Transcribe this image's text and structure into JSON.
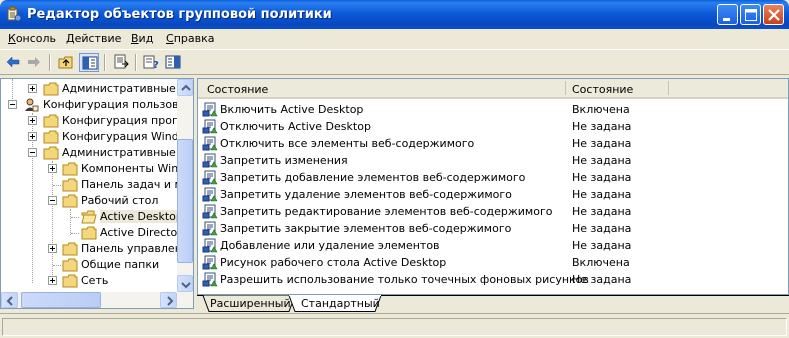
{
  "window": {
    "title": "Редактор объектов групповой политики",
    "controls": [
      "minimize",
      "maximize",
      "close"
    ]
  },
  "menu": {
    "items": [
      {
        "label": "Консоль",
        "accesskey": "К"
      },
      {
        "label": "Действие",
        "accesskey": "Д"
      },
      {
        "label": "Вид",
        "accesskey": "В"
      },
      {
        "label": "Справка",
        "accesskey": "С"
      }
    ]
  },
  "toolbar": {
    "buttons": [
      "back-icon",
      "forward-icon",
      "up-folder-icon",
      "show-hide-tree-icon",
      "export-list-icon",
      "properties-help-icon",
      "show-hide-action-pane-icon"
    ]
  },
  "tree": {
    "items": [
      {
        "label": "Административные ш",
        "expander": "plus"
      },
      {
        "label": "Конфигурация пользоват",
        "expander": "minus"
      },
      {
        "label": "Конфигурация програ",
        "expander": "plus"
      },
      {
        "label": "Конфигурация Window",
        "expander": "plus"
      },
      {
        "label": "Административные ш",
        "expander": "minus"
      },
      {
        "label": "Компоненты Windo",
        "expander": "plus"
      },
      {
        "label": "Панель задач и ме",
        "expander": "none"
      },
      {
        "label": "Рабочий стол",
        "expander": "minus"
      },
      {
        "label": "Active Desktop",
        "expander": "none",
        "selected": true
      },
      {
        "label": "Active Directory",
        "expander": "none"
      },
      {
        "label": "Панель управлени",
        "expander": "plus"
      },
      {
        "label": "Общие папки",
        "expander": "none"
      },
      {
        "label": "Сеть",
        "expander": "plus"
      }
    ]
  },
  "list": {
    "columns": [
      "Состояние",
      "Состояние"
    ],
    "rows": [
      {
        "name": "Включить Active Desktop",
        "state": "Включена"
      },
      {
        "name": "Отключить Active Desktop",
        "state": "Не задана"
      },
      {
        "name": "Отключить все элементы веб-содержимого",
        "state": "Не задана"
      },
      {
        "name": "Запретить изменения",
        "state": "Не задана"
      },
      {
        "name": "Запретить добавление элементов веб-содержимого",
        "state": "Не задана"
      },
      {
        "name": "Запретить удаление элементов веб-содержимого",
        "state": "Не задана"
      },
      {
        "name": "Запретить редактирование элементов веб-содержимого",
        "state": "Не задана"
      },
      {
        "name": "Запретить закрытие элементов веб-содержимого",
        "state": "Не задана"
      },
      {
        "name": "Добавление или удаление элементов",
        "state": "Не задана"
      },
      {
        "name": "Рисунок рабочего стола Active Desktop",
        "state": "Включена"
      },
      {
        "name": "Разрешить использование только точечных фоновых рисунков",
        "state": "Не задана"
      }
    ]
  },
  "tabs": {
    "items": [
      {
        "label": "Расширенный",
        "active": false
      },
      {
        "label": "Стандартный",
        "active": true
      }
    ]
  },
  "colors": {
    "titlebar": "#0B5AD9",
    "selection": "#ECE9D8",
    "window_bg": "#ECE9D8"
  }
}
